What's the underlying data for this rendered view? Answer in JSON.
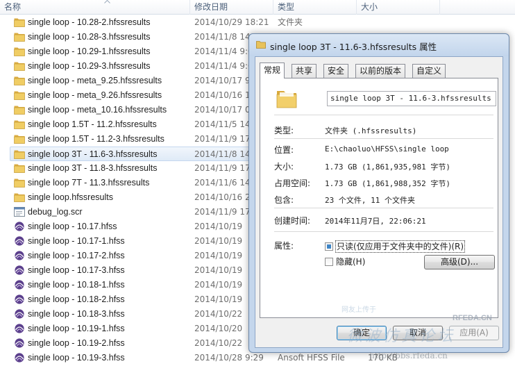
{
  "explorer": {
    "columns": [
      "名称",
      "修改日期",
      "类型",
      "大小"
    ],
    "rows": [
      {
        "icon": "folder-icon",
        "name": "single loop - 10.28-2.hfssresults",
        "date": "2014/10/29 18:21",
        "type": "文件夹",
        "size": ""
      },
      {
        "icon": "folder-icon",
        "name": "single loop - 10.28-3.hfssresults",
        "date": "2014/11/8 14",
        "type": "",
        "size": ""
      },
      {
        "icon": "folder-icon",
        "name": "single loop - 10.29-1.hfssresults",
        "date": "2014/11/4 9:0",
        "type": "",
        "size": ""
      },
      {
        "icon": "folder-icon",
        "name": "single loop - 10.29-3.hfssresults",
        "date": "2014/11/4 9:0",
        "type": "",
        "size": ""
      },
      {
        "icon": "folder-icon",
        "name": "single loop - meta_9.25.hfssresults",
        "date": "2014/10/17 9",
        "type": "",
        "size": ""
      },
      {
        "icon": "folder-icon",
        "name": "single loop - meta_9.26.hfssresults",
        "date": "2014/10/16 1",
        "type": "",
        "size": ""
      },
      {
        "icon": "folder-icon",
        "name": "single loop - meta_10.16.hfssresults",
        "date": "2014/10/17 0",
        "type": "",
        "size": ""
      },
      {
        "icon": "folder-icon",
        "name": "single loop 1.5T - 11.2.hfssresults",
        "date": "2014/11/5 14",
        "type": "",
        "size": ""
      },
      {
        "icon": "folder-icon",
        "name": "single loop 1.5T - 11.2-3.hfssresults",
        "date": "2014/11/9 17",
        "type": "",
        "size": ""
      },
      {
        "icon": "folder-icon",
        "name": "single loop 3T - 11.6-3.hfssresults",
        "date": "2014/11/8 14",
        "type": "",
        "size": "",
        "selected": true
      },
      {
        "icon": "folder-icon",
        "name": "single loop 3T - 11.8-3.hfssresults",
        "date": "2014/11/9 17",
        "type": "",
        "size": ""
      },
      {
        "icon": "folder-icon",
        "name": "single loop 7T - 11.3.hfssresults",
        "date": "2014/11/6 14",
        "type": "",
        "size": ""
      },
      {
        "icon": "folder-icon",
        "name": "single loop.hfssresults",
        "date": "2014/10/16 2",
        "type": "",
        "size": ""
      },
      {
        "icon": "script-file-icon",
        "name": "debug_log.scr",
        "date": "2014/11/9 17",
        "type": "",
        "size": ""
      },
      {
        "icon": "hfss-file-icon",
        "name": "single loop - 10.17.hfss",
        "date": "2014/10/19",
        "type": "",
        "size": ""
      },
      {
        "icon": "hfss-file-icon",
        "name": "single loop - 10.17-1.hfss",
        "date": "2014/10/19",
        "type": "",
        "size": ""
      },
      {
        "icon": "hfss-file-icon",
        "name": "single loop - 10.17-2.hfss",
        "date": "2014/10/19",
        "type": "",
        "size": ""
      },
      {
        "icon": "hfss-file-icon",
        "name": "single loop - 10.17-3.hfss",
        "date": "2014/10/19",
        "type": "",
        "size": ""
      },
      {
        "icon": "hfss-file-icon",
        "name": "single loop - 10.18-1.hfss",
        "date": "2014/10/19",
        "type": "",
        "size": ""
      },
      {
        "icon": "hfss-file-icon",
        "name": "single loop - 10.18-2.hfss",
        "date": "2014/10/19",
        "type": "",
        "size": ""
      },
      {
        "icon": "hfss-file-icon",
        "name": "single loop - 10.18-3.hfss",
        "date": "2014/10/22",
        "type": "",
        "size": ""
      },
      {
        "icon": "hfss-file-icon",
        "name": "single loop - 10.19-1.hfss",
        "date": "2014/10/20",
        "type": "",
        "size": ""
      },
      {
        "icon": "hfss-file-icon",
        "name": "single loop - 10.19-2.hfss",
        "date": "2014/10/22",
        "type": "",
        "size": ""
      },
      {
        "icon": "hfss-file-icon",
        "name": "single loop - 10.19-3.hfss",
        "date": "2014/10/28 9:29",
        "type": "Ansoft HFSS File",
        "size": "170 KB"
      }
    ]
  },
  "dialog": {
    "title": "single loop 3T - 11.6-3.hfssresults 属性",
    "tabs": [
      "常规",
      "共享",
      "安全",
      "以前的版本",
      "自定义"
    ],
    "active_tab": 0,
    "name_value": "single loop 3T - 11.6-3.hfssresults",
    "props": {
      "type_label": "类型:",
      "type_value": "文件夹 (.hfssresults)",
      "location_label": "位置:",
      "location_value": "E:\\chaoluo\\HFSS\\single loop",
      "size_label": "大小:",
      "size_value": "1.73 GB (1,861,935,981 字节)",
      "disk_label": "占用空间:",
      "disk_value": "1.73 GB (1,861,988,352 字节)",
      "contains_label": "包含:",
      "contains_value": "23 个文件, 11 个文件夹",
      "created_label": "创建时间:",
      "created_value": "2014年11月7日, 22:06:21",
      "attrs_label": "属性:"
    },
    "readonly_label": "只读(仅应用于文件夹中的文件)(R)",
    "hidden_label": "隐藏(H)",
    "advanced_label": "高级(D)...",
    "ok_label": "确定",
    "cancel_label": "取消",
    "apply_label": "应用(A)"
  },
  "watermark": {
    "forum_text": "微波仿真论坛",
    "url_text": "http://bbs.rfeda.cn",
    "logo_text": "RFEDA.CN",
    "small_text": "网友上传于"
  },
  "colors": {
    "selection": "#dfeaf7",
    "dialog_frame": "#c4d6ec",
    "folder": "#e8c25a",
    "hfss_icon": "#5b3f8c"
  }
}
